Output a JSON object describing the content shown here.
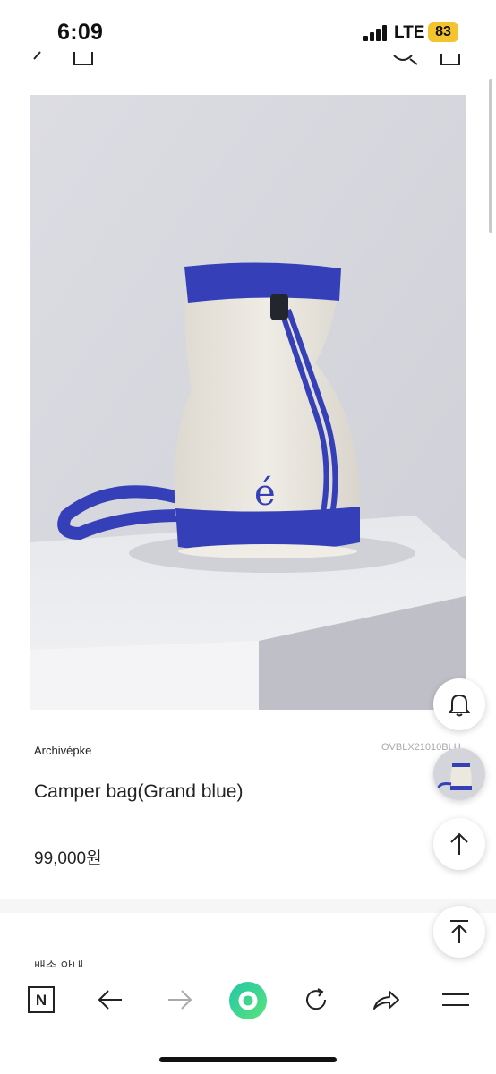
{
  "status_bar": {
    "time": "6:09",
    "network": "LTE",
    "battery": "83"
  },
  "header": {
    "icons": [
      "back-icon",
      "home-icon",
      "search-icon",
      "cart-icon"
    ]
  },
  "product": {
    "image_logo": "é",
    "brand": "Archivépke",
    "sku": "OVBLX21010BLU",
    "title": "Camper bag(Grand blue)",
    "price": "99,000원",
    "section_text": "배송 안내"
  },
  "floating_buttons": [
    "bell-icon",
    "product-thumbnail",
    "arrow-up-icon",
    "scroll-top-icon"
  ],
  "toolbar": {
    "n_label": "N",
    "items": [
      "n-icon",
      "back-arrow-icon",
      "forward-arrow-icon",
      "green-home-icon",
      "reload-icon",
      "share-icon",
      "menu-icon"
    ]
  },
  "colors": {
    "bag_blue": "#3540b8",
    "bag_canvas": "#ebe8e0",
    "background": "#ffffff",
    "green_accent": "#3dd6a0"
  }
}
